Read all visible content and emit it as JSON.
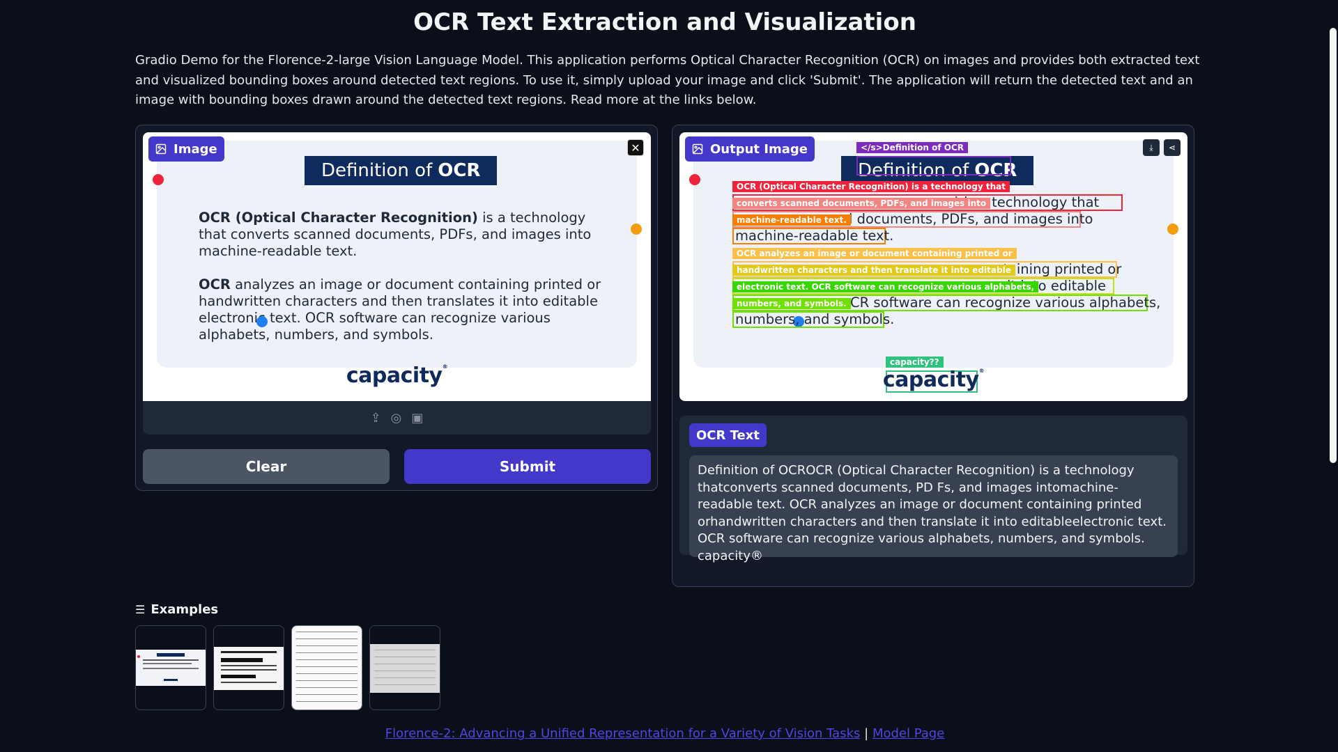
{
  "page": {
    "title": "OCR Text Extraction and Visualization",
    "description": "Gradio Demo for the Florence-2-large Vision Language Model. This application performs Optical Character Recognition (OCR) on images and provides both extracted text and visualized bounding boxes around detected text regions. To use it, simply upload your image and click 'Submit'. The application will return the detected text and an image with bounding boxes drawn around the detected text regions. Read more at the links below."
  },
  "input_panel": {
    "label": "Image",
    "slide_title_prefix": "Definition of",
    "slide_title_bold": "OCR",
    "para1_bold": "OCR (Optical Character Recognition)",
    "para1_rest": " is a technology that converts scanned documents, PDFs, and images into machine-readable text.",
    "para2_bold": "OCR",
    "para2_rest": " analyzes an image or document containing printed or handwritten characters and then translates it into editable electronic text. OCR software can recognize various alphabets, numbers, and symbols.",
    "logo": "capacity",
    "close_icon": "close-icon",
    "upload_icons": [
      "upload-icon",
      "webcam-icon",
      "clipboard-icon"
    ]
  },
  "buttons": {
    "clear": "Clear",
    "submit": "Submit"
  },
  "output_panel": {
    "label": "Output Image",
    "overlay_labels": [
      "</s>Definition of OCR",
      "OCR (Optical Character Recognition) is a technology that",
      "converts scanned documents, PDFs, and images into",
      "machine-readable text.",
      "OCR analyzes an image or document containing printed or",
      "handwritten characters and then translate it into editable",
      "electronic text. OCR software can recognize various alphabets,",
      "numbers, and symbols.",
      "capacity??"
    ],
    "line_texts": [
      "Definition of OCR",
      "n) is a technology that",
      "d documents, PDFs, and images into",
      "machine-readable text.",
      "ontaining printed or",
      "it into editable",
      "CR software can recognize various alphabets,",
      "numbers, and symbols.",
      "capacity"
    ],
    "download_icon": "download-icon",
    "share_icon": "share-icon"
  },
  "ocr_text": {
    "label": "OCR Text",
    "value": "Definition of OCROCR (Optical Character Recognition) is a technology thatconverts scanned documents, PD Fs, and images intomachine-readable text. OCR analyzes an image or document containing printed orhandwritten characters and then translate it into editableelectronic text. OCR software can recognize various alphabets, numbers, and symbols. capacity®"
  },
  "examples": {
    "label": "Examples"
  },
  "footer": {
    "link1": "Florence-2: Advancing a Unified Representation for a Variety of Vision Tasks",
    "separator": "|",
    "link2": "Model Page"
  },
  "colors": {
    "accent": "#4338ca",
    "background": "#0b0f19",
    "red": "#ef233c",
    "salmon": "#f28482",
    "orange": "#f77f00",
    "amber": "#fcbf49",
    "green": "#38d600",
    "lime": "#70e000",
    "mint": "#2ec27e",
    "purple": "#7b2cbf"
  }
}
